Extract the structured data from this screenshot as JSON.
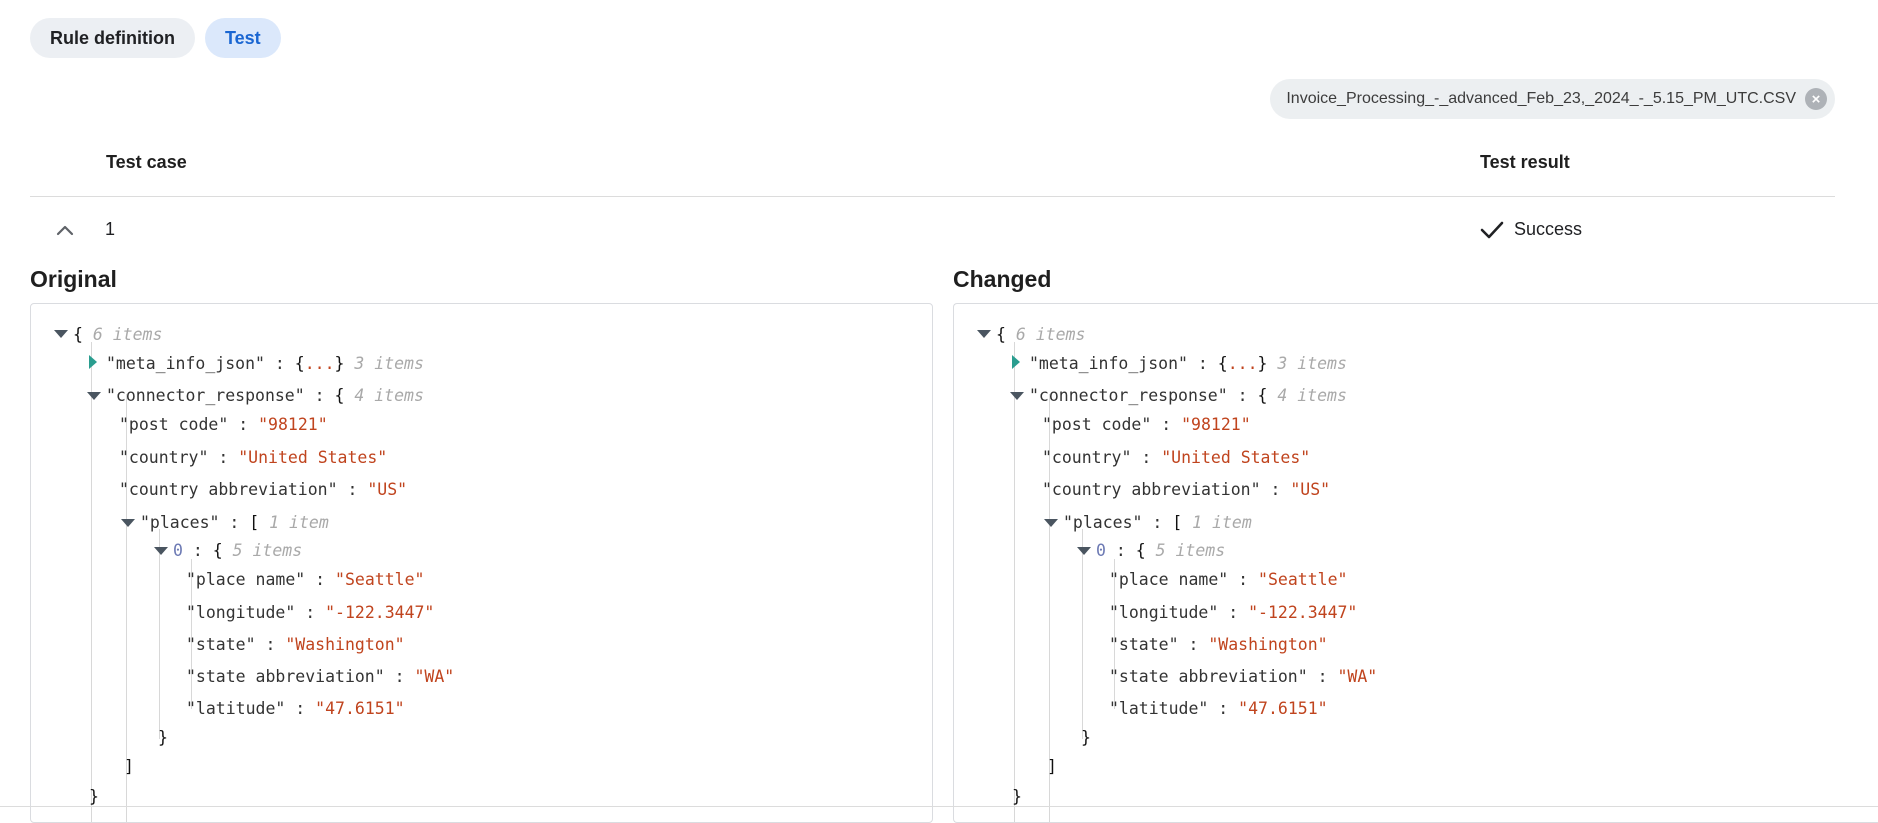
{
  "tabs": [
    {
      "label": "Rule definition",
      "active": false
    },
    {
      "label": "Test",
      "active": true
    }
  ],
  "file_chip": {
    "filename": "Invoice_Processing_-_advanced_Feb_23,_2024_-_5.15_PM_UTC.CSV",
    "close_glyph": "×"
  },
  "table": {
    "headers": {
      "test_case": "Test case",
      "test_result": "Test result"
    },
    "rows": [
      {
        "number": "1",
        "expanded": true,
        "result": "Success",
        "result_icon": "check-icon"
      }
    ]
  },
  "panes": [
    {
      "title": "Original",
      "json": {
        "root_count": "6 items",
        "meta_key": "\"meta_info_json\"",
        "meta_collapsed": "...",
        "meta_count": "3 items",
        "connector_key": "\"connector_response\"",
        "connector_count": "4 items",
        "post_code_key": "\"post code\"",
        "post_code_val": "\"98121\"",
        "country_key": "\"country\"",
        "country_val": "\"United States\"",
        "country_abbr_key": "\"country abbreviation\"",
        "country_abbr_val": "\"US\"",
        "places_key": "\"places\"",
        "places_count": "1 item",
        "place_index": "0",
        "place_count": "5 items",
        "place_name_key": "\"place name\"",
        "place_name_val": "\"Seattle\"",
        "longitude_key": "\"longitude\"",
        "longitude_val": "\"-122.3447\"",
        "state_key": "\"state\"",
        "state_val": "\"Washington\"",
        "state_abbr_key": "\"state abbreviation\"",
        "state_abbr_val": "\"WA\"",
        "latitude_key": "\"latitude\"",
        "latitude_val": "\"47.6151\""
      }
    },
    {
      "title": "Changed",
      "json": {
        "root_count": "6 items",
        "meta_key": "\"meta_info_json\"",
        "meta_collapsed": "...",
        "meta_count": "3 items",
        "connector_key": "\"connector_response\"",
        "connector_count": "4 items",
        "post_code_key": "\"post code\"",
        "post_code_val": "\"98121\"",
        "country_key": "\"country\"",
        "country_val": "\"United States\"",
        "country_abbr_key": "\"country abbreviation\"",
        "country_abbr_val": "\"US\"",
        "places_key": "\"places\"",
        "places_count": "1 item",
        "place_index": "0",
        "place_count": "5 items",
        "place_name_key": "\"place name\"",
        "place_name_val": "\"Seattle\"",
        "longitude_key": "\"longitude\"",
        "longitude_val": "\"-122.3447\"",
        "state_key": "\"state\"",
        "state_val": "\"Washington\"",
        "state_abbr_key": "\"state abbreviation\"",
        "state_abbr_val": "\"WA\"",
        "latitude_key": "\"latitude\"",
        "latitude_val": "\"47.6151\""
      }
    }
  ],
  "colors": {
    "accent": "#1a66d2",
    "string": "#c0441e",
    "index": "#6d7ab4",
    "count": "#a9a9a9"
  }
}
